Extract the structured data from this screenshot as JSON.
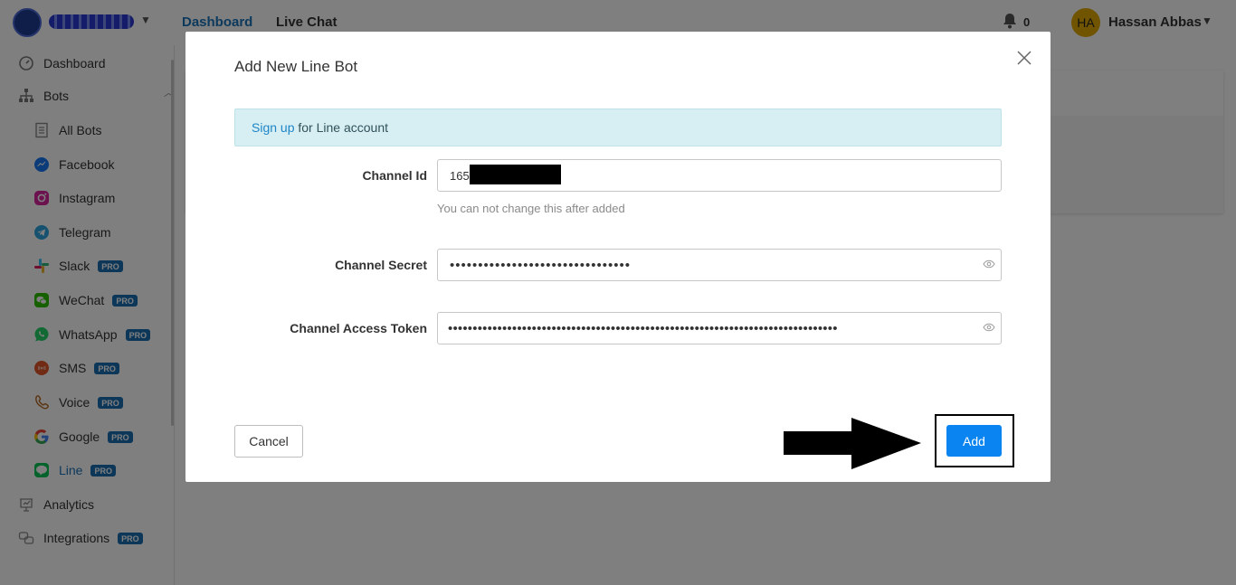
{
  "topbar": {
    "nav": [
      {
        "label": "Dashboard"
      },
      {
        "label": "Live Chat"
      }
    ],
    "notifications_count": "0",
    "user_initials": "HA",
    "user_name": "Hassan Abbas"
  },
  "sidebar": {
    "items": [
      {
        "label": "Dashboard",
        "icon": "dashboard-icon"
      },
      {
        "label": "Bots",
        "icon": "sitemap-icon"
      },
      {
        "label": "All Bots",
        "icon": "list-icon"
      },
      {
        "label": "Facebook",
        "icon": "messenger-icon"
      },
      {
        "label": "Instagram",
        "icon": "instagram-icon"
      },
      {
        "label": "Telegram",
        "icon": "telegram-icon"
      },
      {
        "label": "Slack",
        "icon": "slack-icon",
        "badge": "PRO"
      },
      {
        "label": "WeChat",
        "icon": "wechat-icon",
        "badge": "PRO"
      },
      {
        "label": "WhatsApp",
        "icon": "whatsapp-icon",
        "badge": "PRO"
      },
      {
        "label": "SMS",
        "icon": "sms-icon",
        "badge": "PRO"
      },
      {
        "label": "Voice",
        "icon": "phone-icon",
        "badge": "PRO"
      },
      {
        "label": "Google",
        "icon": "google-icon",
        "badge": "PRO"
      },
      {
        "label": "Line",
        "icon": "line-icon",
        "badge": "PRO"
      },
      {
        "label": "Analytics",
        "icon": "analytics-icon"
      },
      {
        "label": "Integrations",
        "icon": "integrations-icon",
        "badge": "PRO"
      }
    ]
  },
  "modal": {
    "title": "Add New Line Bot",
    "alert_link": "Sign up",
    "alert_text": " for Line account",
    "channel_id_label": "Channel Id",
    "channel_id_value": "165",
    "channel_id_help": "You can not change this after added",
    "channel_secret_label": "Channel Secret",
    "channel_secret_value": "••••••••••••••••••••••••••••••••",
    "channel_token_label": "Channel Access Token",
    "channel_token_value": "•••••••••••••••••••••••••••••••••••••••••••••••••••••••••••••••••••••••••••••••",
    "cancel_label": "Cancel",
    "add_label": "Add"
  },
  "colors": {
    "accent": "#0a84f0",
    "link": "#1a73b8",
    "pro_badge": "#1b6fb3",
    "alert_bg": "#d7eef3"
  }
}
